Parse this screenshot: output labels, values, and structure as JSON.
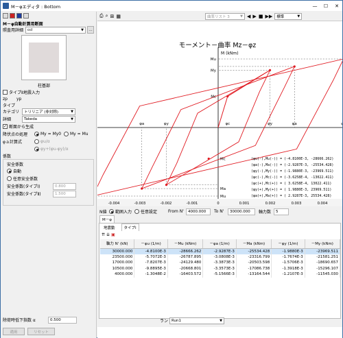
{
  "window": {
    "title": "M－φエディタ : Bottom"
  },
  "left": {
    "section_title": "M－φ自動計算用断面",
    "member_label": "照査用詳細",
    "member_value": "ccl",
    "section_caption": "柱基部",
    "type2_check": "タイプⅡ地震入力",
    "zp": "zp",
    "yp": "yp",
    "type_label": "タイプ",
    "category_label": "カテゴリ",
    "category_value": "トリリニア (非対称)",
    "detail_label": "詳細",
    "detail_value": "Takeda",
    "auto_gen": "断面から生成",
    "yield_label": "降伏点の処理",
    "yield_opt1": "My = My0",
    "yield_opt2": "My = Mu",
    "phi_a_label": "φａ計算式",
    "phi_a_opt1": "φu/α",
    "phi_a_opt2": "φy+(φu-φy)/α",
    "coef_title": "係数",
    "safety_title": "安全係数",
    "auto": "自動",
    "optional": "任意安全係数",
    "sf1_label": "安全係数(タイプⅠ)",
    "sf1_value": "0.800",
    "sf2_label": "安全係数(タイプⅡ)",
    "sf2_value": "1.500",
    "reduction_label": "除荷時低下指数 α",
    "reduction_value": "0.500",
    "apply": "適用",
    "reset": "リセット"
  },
  "toolbar": {
    "list_value": "曲率リスト 3",
    "mode_value": "標準"
  },
  "chart_data": {
    "type": "line",
    "title": "モーメント－曲率 Mz－φz",
    "xlabel": "φ (1/m)",
    "ylabel": "M (kNm)",
    "xlim": [
      -0.006,
      0.006
    ],
    "x_ticks": [
      "-0.006",
      "-0.005",
      "-0.004",
      "-0.003",
      "-0.002",
      "-0.001",
      "0",
      "0.001",
      "0.002",
      "0.003",
      "0.004",
      "0.005",
      "0.006"
    ],
    "points_pos": [
      {
        "x": 0.001988,
        "y": 23969.511
      },
      {
        "x": 0.0029287,
        "y": 25534.428
      },
      {
        "x": 0.00481,
        "y": 28666.262
      }
    ],
    "points_neg": [
      {
        "x": -0.001988,
        "y": -23969.511
      },
      {
        "x": -0.0029287,
        "y": -25534.428
      },
      {
        "x": -0.00481,
        "y": -28666.262
      }
    ],
    "crack": {
      "x": 0.00036258,
      "y": 13022.411
    },
    "hysteresis_color": "#e11b22",
    "skeleton_color": "#3a3ab8",
    "y_labels_pos": [
      "Mu",
      "My",
      "Mc"
    ],
    "y_labels_neg": [
      "Mc",
      "Ma",
      "Mu"
    ],
    "x_labels": [
      "φu",
      "φa",
      "φy",
      "φc",
      "φy",
      "φa",
      "φu"
    ],
    "legend": [
      "(φu(-),Mu(-)) = (-4.8100E-3, -28666.262)",
      "(φa(-),Ma(-)) = (-2.9287E-3, -25534.428)",
      "(φy(-),My(-)) = (-1.9880E-3, -23969.511)",
      "(φc(-),Mc(-)) = (-3.6258E-4, -13022.411)",
      "(φc(+),Mc(+)) = ( 3.6258E-4,  13022.411)",
      "(φy(+),My(+)) = ( 1.9880E-3,  23969.511)",
      "(φa(+),Ma(+)) = ( 2.9287E-3,  25534.428)",
      "(φu(+),Mu(+)) = ( 4.8100E-3,  28666.262)"
    ]
  },
  "nvalue": {
    "label": "N値",
    "opt1": "範囲入力",
    "opt2": "任意設定",
    "from_label": "From N'",
    "from_value": "4000.000",
    "to_label": "To N'",
    "to_value": "30000.000",
    "count_label": "軸力数",
    "count_value": "5"
  },
  "tabs1": [
    "M－φ"
  ],
  "tabs2": [
    "地震動",
    "タイプⅠ"
  ],
  "table": {
    "headers": [
      "軸力 N' (kN)",
      "－φu (1/m)",
      "－Mu (kNm)",
      "－φa (1/m)",
      "－Ma (kNm)",
      "－φy (1/m)",
      "－My (kNm)"
    ],
    "rows": [
      [
        "30000.000",
        "-4.8100E-3",
        "-28666.262",
        "-2.9287E-3",
        "-25534.428",
        "-1.9880E-3",
        "-23969.511"
      ],
      [
        "23500.000",
        "-5.7072E-3",
        "-26787.895",
        "-3.0808E-3",
        "-23316.799",
        "-1.7674E-3",
        "-21581.251"
      ],
      [
        "17000.000",
        "-7.8207E-3",
        "-24129.480",
        "-3.3873E-3",
        "-20503.598",
        "-1.5706E-3",
        "-18690.657"
      ],
      [
        "10500.000",
        "-9.8895E-3",
        "-20668.801",
        "-3.3573E-3",
        "-17086.738",
        "-1.3918E-3",
        "-15296.107"
      ],
      [
        "4000.000",
        "-1.3048E-2",
        "-16403.572",
        "-5.1566E-3",
        "-13164.544",
        "-1.2107E-3",
        "-11545.030"
      ]
    ]
  },
  "run": {
    "label": "ラン",
    "value": "Run1"
  }
}
